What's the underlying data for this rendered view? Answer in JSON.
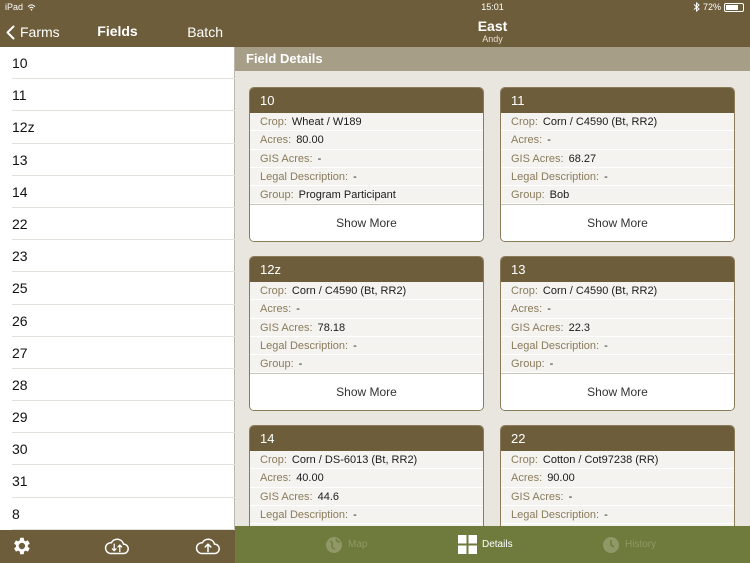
{
  "status": {
    "device": "iPad",
    "time": "15:01",
    "battery": "72%",
    "battery_fraction": 0.72
  },
  "left_header": {
    "back_label": "Farms",
    "title": "Fields",
    "batch_label": "Batch"
  },
  "fields": [
    "10",
    "11",
    "12z",
    "13",
    "14",
    "22",
    "23",
    "25",
    "26",
    "27",
    "28",
    "29",
    "30",
    "31",
    "8"
  ],
  "left_toolbar": {
    "icons": [
      "gear-icon",
      "cloud-sync-icon",
      "cloud-upload-icon"
    ]
  },
  "header": {
    "title": "East",
    "subtitle": "Andy"
  },
  "section": {
    "title": "Field Details"
  },
  "card_labels": {
    "crop": "Crop:",
    "acres": "Acres:",
    "gis_acres": "GIS Acres:",
    "legal": "Legal Description:",
    "group": "Group:",
    "show_more": "Show More"
  },
  "cards": [
    {
      "name": "10",
      "crop": "Wheat / W189",
      "acres": "80.00",
      "gis_acres": "-",
      "legal": "-",
      "group": "Program Participant"
    },
    {
      "name": "11",
      "crop": "Corn / C4590 (Bt, RR2)",
      "acres": "-",
      "gis_acres": "68.27",
      "legal": "-",
      "group": "Bob"
    },
    {
      "name": "12z",
      "crop": "Corn / C4590 (Bt, RR2)",
      "acres": "-",
      "gis_acres": "78.18",
      "legal": "-",
      "group": "-"
    },
    {
      "name": "13",
      "crop": "Corn / C4590 (Bt, RR2)",
      "acres": "-",
      "gis_acres": "22.3",
      "legal": "-",
      "group": "-"
    },
    {
      "name": "14",
      "crop": "Corn / DS-6013 (Bt, RR2)",
      "acres": "40.00",
      "gis_acres": "44.6",
      "legal": "-",
      "group": ""
    },
    {
      "name": "22",
      "crop": "Cotton / Cot97238 (RR)",
      "acres": "90.00",
      "gis_acres": "-",
      "legal": "-",
      "group": ""
    }
  ],
  "tabs": {
    "map": "Map",
    "details": "Details",
    "history": "History"
  },
  "colors": {
    "brand_brown": "#6e5d3b",
    "section_tan": "#a79e88",
    "tabbar_olive": "#6f7a3d",
    "label_tan": "#8a7b5c"
  }
}
